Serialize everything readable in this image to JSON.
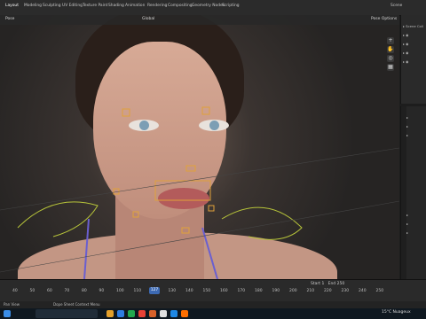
{
  "menubar": {
    "workspaces": [
      "Layout",
      "Modeling",
      "Sculpting",
      "UV Editing",
      "Texture Paint",
      "Shading",
      "Animation",
      "Rendering",
      "Compositing",
      "Geometry Nodes",
      "Scripting"
    ],
    "scene": "Scene"
  },
  "viewport": {
    "mode": "Pose",
    "orientation": "Global",
    "options": "Pose Options"
  },
  "timeline": {
    "start_label": "Start",
    "start": "1",
    "end_label": "End",
    "end": "250",
    "current_frame": "127",
    "frames": [
      "40",
      "50",
      "60",
      "70",
      "80",
      "90",
      "100",
      "110",
      "120",
      "130",
      "140",
      "150",
      "160",
      "170",
      "180",
      "190",
      "200",
      "210",
      "220",
      "230",
      "240",
      "250"
    ]
  },
  "statusbar": {
    "left": "Pan View",
    "center": "Dope Sheet Context Menu"
  },
  "taskbar": {
    "search_placeholder": "",
    "weather": "15°C Nuageux",
    "icon_colors": [
      "#e3a02b",
      "#2f7de1",
      "#23a84f",
      "#e84236",
      "#d6612a",
      "#e0e0e0",
      "#1e88e5",
      "#ff6f00"
    ]
  }
}
